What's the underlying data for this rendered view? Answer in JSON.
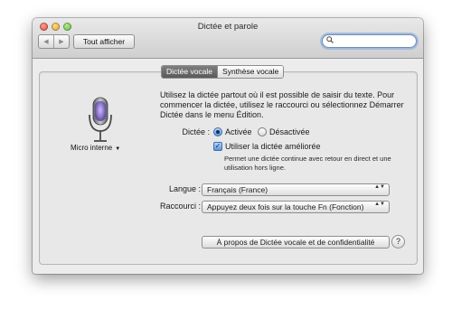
{
  "window": {
    "title": "Dictée et parole"
  },
  "toolbar": {
    "back_glyph": "◀",
    "forward_glyph": "▶",
    "show_all_label": "Tout afficher",
    "search": {
      "value": "",
      "icon": "search-icon"
    }
  },
  "tabs": [
    {
      "label": "Dictée vocale",
      "active": true
    },
    {
      "label": "Synthèse vocale",
      "active": false
    }
  ],
  "mic": {
    "source_label": "Micro interne",
    "caret": "▼",
    "icon": "microphone-icon"
  },
  "intro_text": "Utilisez la dictée partout où il est possible de saisir du texte. Pour commencer la dictée, utilisez le raccourci ou sélectionnez Démarrer Dictée dans le menu Édition.",
  "dictation": {
    "label": "Dictée :",
    "on_label": "Activée",
    "off_label": "Désactivée",
    "selected": "Activée"
  },
  "enhanced": {
    "label": "Utiliser la dictée améliorée",
    "checked": true,
    "check_glyph": "✓",
    "note": "Permet une dictée continue avec retour en direct et une utilisation hors ligne."
  },
  "language": {
    "label": "Langue :",
    "value": "Français (France)"
  },
  "shortcut": {
    "label": "Raccourci :",
    "value": "Appuyez deux fois sur la touche Fn (Fonction)"
  },
  "popup_arrows": "▲▼",
  "about_button": "À propos de Dictée vocale et de confidentialité",
  "help_glyph": "?",
  "colors": {
    "active_tab": "#6b6b6b",
    "mic_glow": "#9a7fe0",
    "focus_ring": "#78a0dc"
  }
}
